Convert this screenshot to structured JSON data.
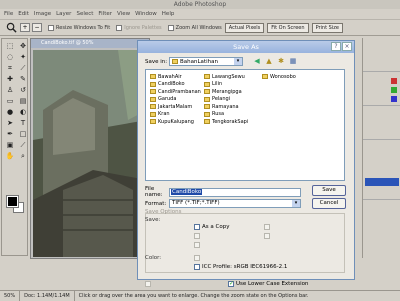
{
  "app": {
    "title": "Adobe Photoshop"
  },
  "menu": [
    "File",
    "Edit",
    "Image",
    "Layer",
    "Select",
    "Filter",
    "View",
    "Window",
    "Help"
  ],
  "options": {
    "resize_windows": "Resize Windows To Fit",
    "ignore_palettes": "Ignore Palettes",
    "zoom_all": "Zoom All Windows",
    "actual_pixels": "Actual Pixels",
    "fit_on_screen": "Fit On Screen",
    "print_size": "Print Size"
  },
  "document": {
    "title": "CandiBoko.tif @ 50%"
  },
  "dialog": {
    "title": "Save As",
    "help_glyph": "?",
    "close_glyph": "×",
    "save_in_label": "Save in:",
    "save_in_value": "BahanLatihan",
    "files": [
      [
        "BawahAir",
        "CandiBoko",
        "CandiPrambanan",
        "Garuda",
        "JakartaMalam",
        "Kran",
        "KupuKalupang"
      ],
      [
        "LawangSewu",
        "Lilin",
        "Merangipga",
        "Pelangi",
        "Ramayana",
        "Rusa",
        "TengkorakSapi"
      ],
      [
        "Wonosobo"
      ]
    ],
    "file_name_label": "File name:",
    "file_name_value": "CandiBoko",
    "format_label": "Format:",
    "format_value": "TIFF (*.TIF;*.TIFF)",
    "save_button": "Save",
    "cancel_button": "Cancel",
    "save_options_label": "Save Options",
    "save_label": "Save:",
    "as_a_copy": "As a Copy",
    "color_label": "Color:",
    "icc_profile": "ICC Profile:  sRGB IEC61966-2.1",
    "use_lower_case": "Use Lower Case Extension"
  },
  "status": {
    "zoom": "50%",
    "doc": "Doc: 1.14M/1.14M",
    "hint": "Click or drag over the area you want to enlarge. Change the zoom state on the Options bar."
  },
  "colors": {
    "dialog_title": "#98b3de",
    "selection": "#1f4aa8"
  }
}
